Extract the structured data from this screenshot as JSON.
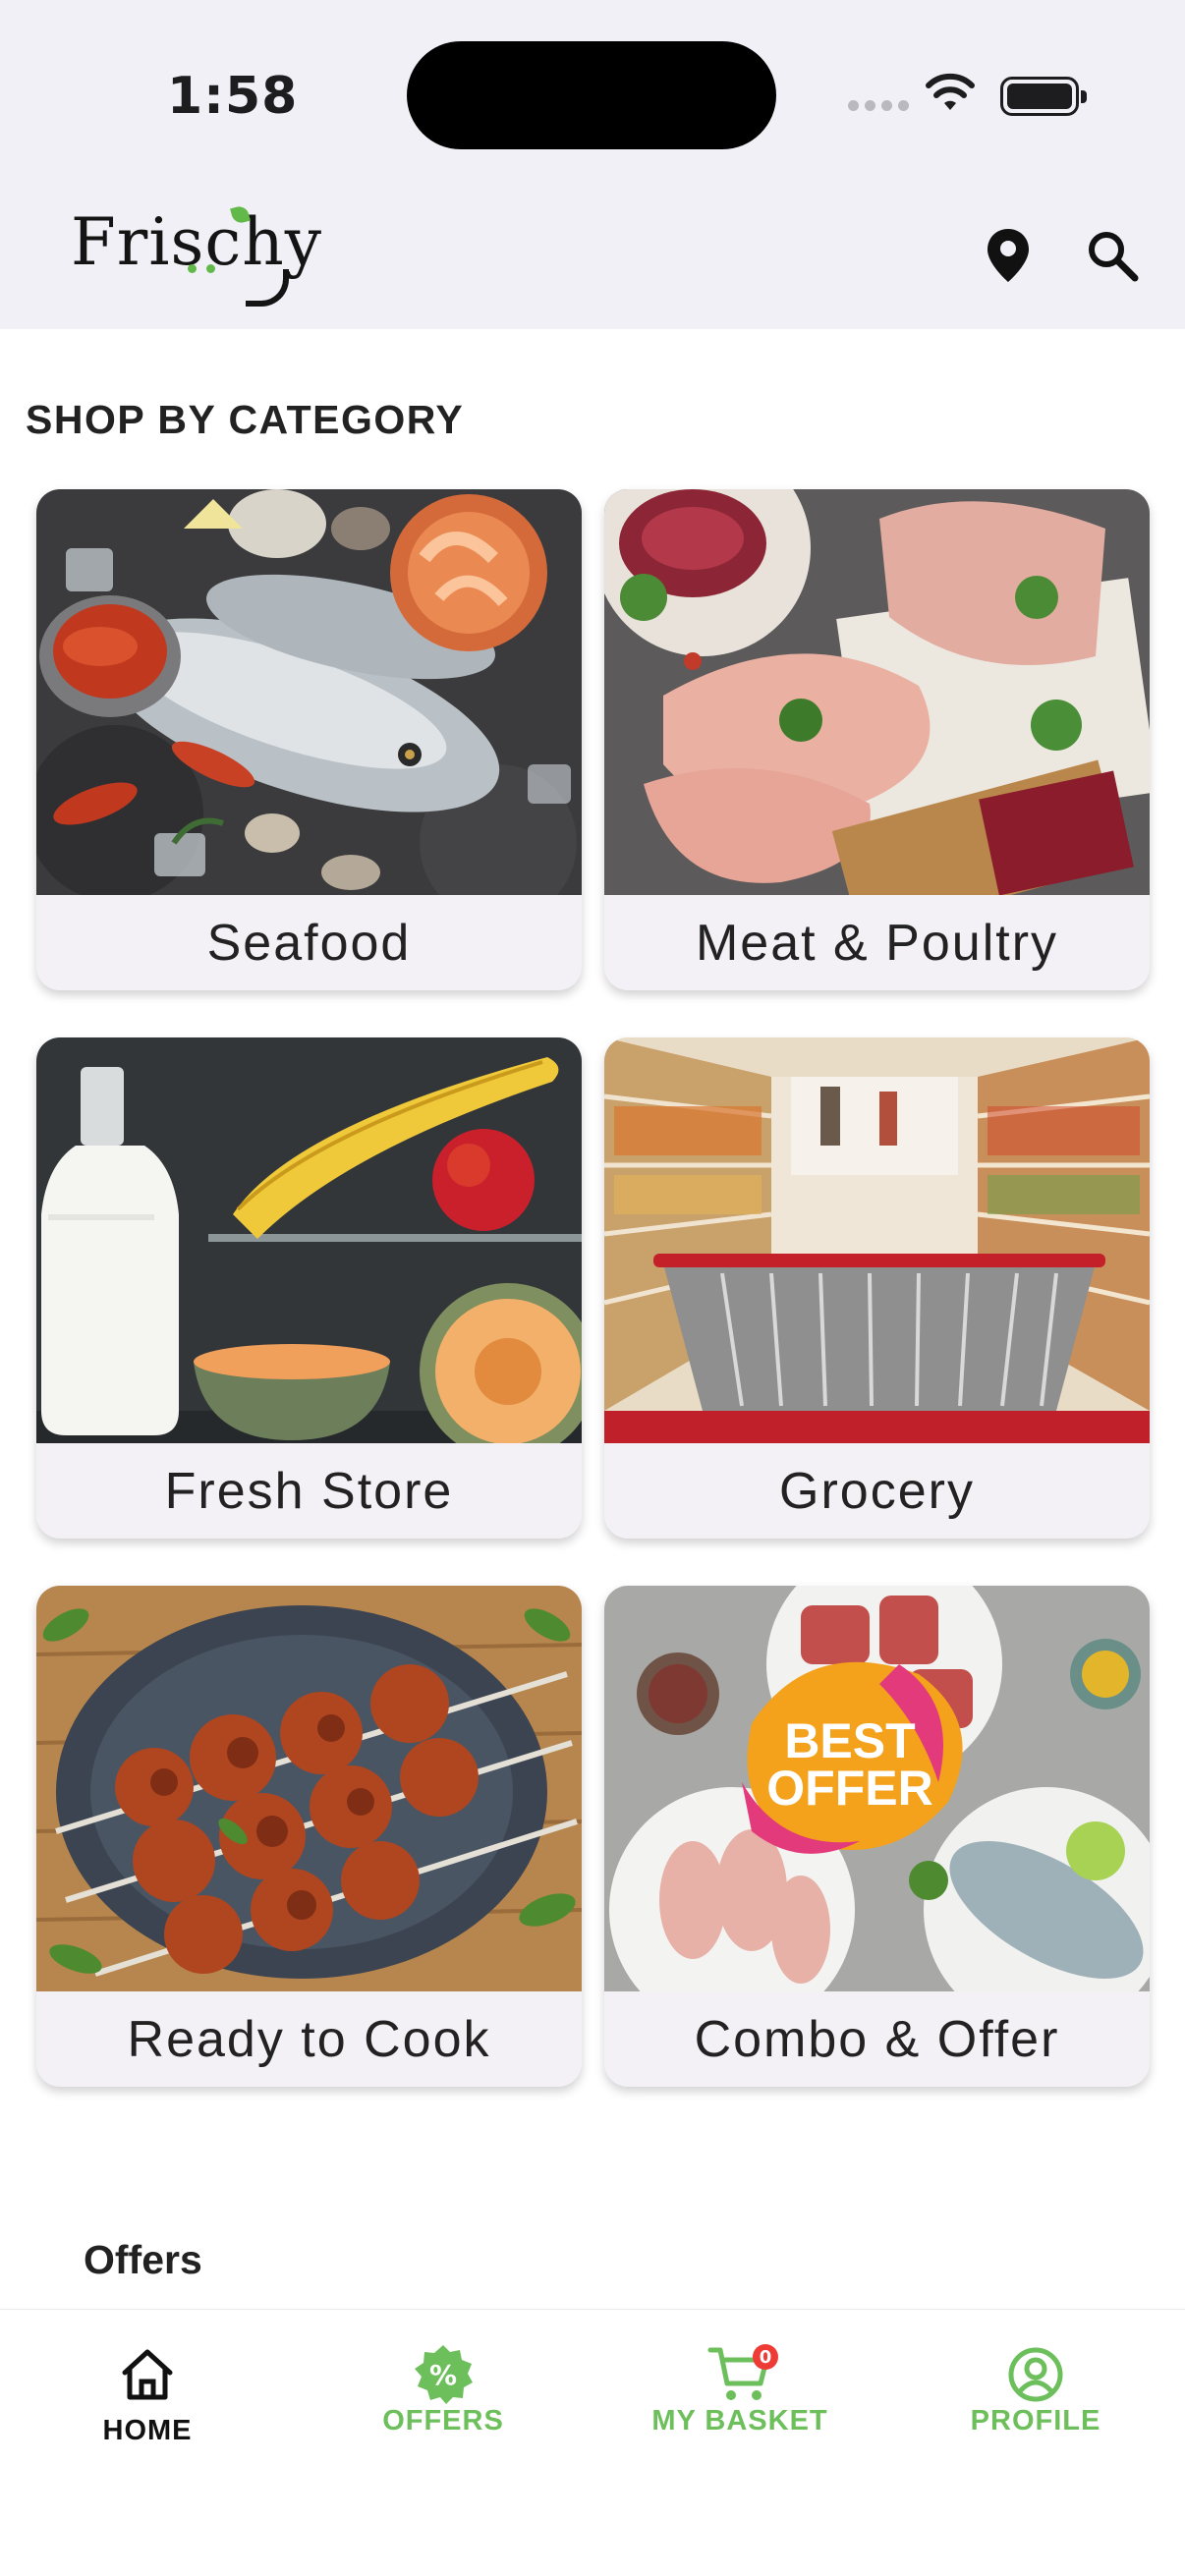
{
  "status_bar": {
    "time": "1:58"
  },
  "header": {
    "logo": "Frischy"
  },
  "section": {
    "title": "SHOP BY CATEGORY"
  },
  "categories": [
    {
      "label": "Seafood"
    },
    {
      "label": "Meat & Poultry"
    },
    {
      "label": "Fresh Store"
    },
    {
      "label": "Grocery"
    },
    {
      "label": "Ready to Cook"
    },
    {
      "label": "Combo & Offer"
    }
  ],
  "combo_badge": {
    "line1": "BEST",
    "line2": "OFFER"
  },
  "offers": {
    "title": "Offers"
  },
  "bottom_nav": {
    "items": [
      {
        "label": "HOME",
        "icon": "home-icon"
      },
      {
        "label": "OFFERS",
        "icon": "offer-badge-icon"
      },
      {
        "label": "MY BASKET",
        "icon": "cart-icon"
      },
      {
        "label": "PROFILE",
        "icon": "profile-icon"
      }
    ],
    "basket_count": "0",
    "active_color": "#111111",
    "inactive_color": "#6cbf5b"
  }
}
